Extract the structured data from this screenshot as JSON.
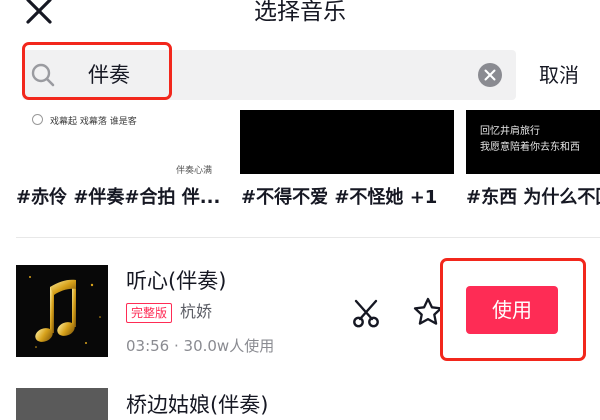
{
  "header": {
    "title": "选择音乐",
    "close_icon": "close-icon"
  },
  "search": {
    "query": "伴奏",
    "search_icon": "search-icon",
    "clear_icon": "clear-icon",
    "cancel_label": "取消",
    "highlight_color": "#f2271c"
  },
  "thumbnails": [
    {
      "lines": [
        "戏幕起 戏幕落 谁是客"
      ],
      "caption": "伴奏心满"
    },
    {
      "lines": []
    },
    {
      "lines": [
        "回忆井肩旅行",
        "我愿意陪着你去东和西"
      ]
    }
  ],
  "tags": [
    "#赤伶 #伴奏#合拍 伴...",
    "#不得不爱 #不怪她 +1",
    "#东西 为什么不回"
  ],
  "songs": [
    {
      "title": "听心(伴奏)",
      "badge": "完整版",
      "artist": "杭娇",
      "meta": "03:56 · 30.0w人使用",
      "cut_icon": "scissors-icon",
      "favorite_icon": "star-icon",
      "use_label": "使用"
    },
    {
      "title": "桥边姑娘(伴奏)"
    }
  ],
  "colors": {
    "accent": "#fe2c55",
    "text_primary": "#161823",
    "text_secondary": "#8a8b91",
    "search_bg": "#f1f1f2"
  }
}
